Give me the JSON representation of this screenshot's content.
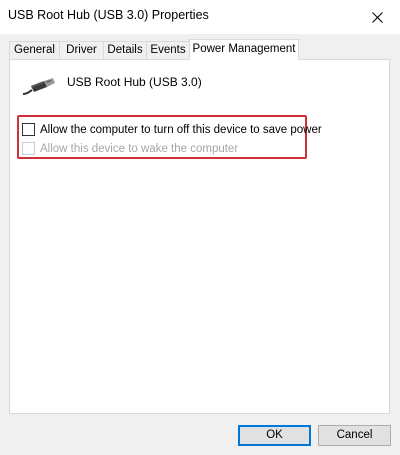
{
  "window": {
    "title": "USB Root Hub (USB 3.0) Properties",
    "close_icon": "close-icon"
  },
  "tabs": [
    {
      "label": "General",
      "active": false
    },
    {
      "label": "Driver",
      "active": false
    },
    {
      "label": "Details",
      "active": false
    },
    {
      "label": "Events",
      "active": false
    },
    {
      "label": "Power Management",
      "active": true
    }
  ],
  "device": {
    "icon": "usb-plug-icon",
    "name": "USB Root Hub (USB 3.0)"
  },
  "options": [
    {
      "label": "Allow the computer to turn off this device to save power",
      "checked": false,
      "enabled": true
    },
    {
      "label": "Allow this device to wake the computer",
      "checked": false,
      "enabled": false
    }
  ],
  "highlight_color": "#d32f3a",
  "buttons": {
    "ok_label": "OK",
    "cancel_label": "Cancel"
  }
}
